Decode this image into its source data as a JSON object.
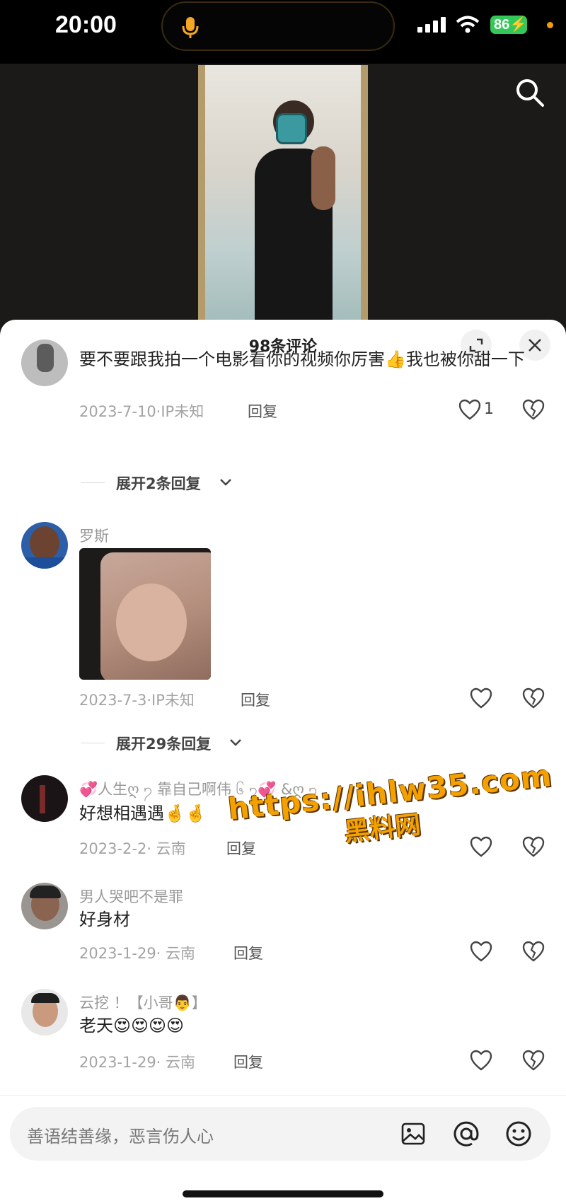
{
  "status_bar": {
    "time": "20:00",
    "battery": "86"
  },
  "sheet": {
    "title": "98条评论",
    "comments": [
      {
        "username": "",
        "text": "要不要跟我拍一个电影看你的视频你厉害👍我也被你甜一下",
        "date": "2023-7-10·IP未知",
        "reply": "回复",
        "likes": "1",
        "expand": "展开2条回复"
      },
      {
        "username": "罗斯",
        "text": "",
        "date": "2023-7-3·IP未知",
        "reply": "回复",
        "likes": "",
        "expand": "展开29条回复"
      },
      {
        "username": "💞人生ღ ႒ 靠自己啊伟 ၆ ႒💞 &ღ ႒",
        "text": "好想相遇遇🤞🤞",
        "date": "2023-2-2· 云南",
        "reply": "回复",
        "likes": ""
      },
      {
        "username": "男人哭吧不是罪",
        "text": "好身材",
        "date": "2023-1-29· 云南",
        "reply": "回复",
        "likes": ""
      },
      {
        "username": "云挖 ！【小哥👨】",
        "text": "老天😍😍😍😍",
        "date": "2023-1-29· 云南",
        "reply": "回复",
        "likes": ""
      }
    ]
  },
  "watermark": {
    "url": "https://ihlw35.com",
    "name": "黑料网"
  },
  "input": {
    "placeholder": "善语结善缘，恶言伤人心"
  },
  "icons": [
    "mic-icon",
    "signal-icon",
    "wifi-icon",
    "search-icon",
    "expand-icon",
    "close-icon",
    "heart-icon",
    "dislike-icon",
    "chevron-down-icon",
    "image-icon",
    "at-icon",
    "emoji-icon"
  ],
  "colors": {
    "accent_battery": "#34c759",
    "watermark": "#f4a100"
  }
}
